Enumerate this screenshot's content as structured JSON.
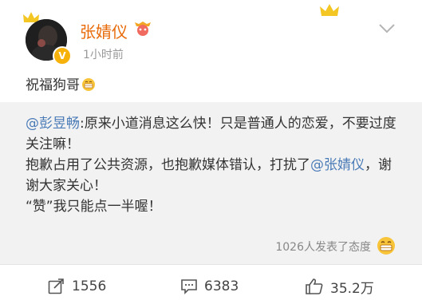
{
  "post": {
    "username": "张婧仪",
    "timestamp": "1小时前",
    "text": "祝福狗哥"
  },
  "repost": {
    "mention_author": "@彭昱畅",
    "segment1": ":原来小道消息这么快！只是普通人的恋爱，不要过度关注嘛！",
    "segment2": "抱歉占用了公共资源，也抱歉媒体错认，打扰了",
    "mention_target": "@张婧仪",
    "segment3": "，谢谢大家关心！",
    "segment4": "“赞”我只能点一半喔！"
  },
  "reactions": {
    "text": "1026人发表了态度"
  },
  "actions": {
    "repost_count": "1556",
    "comment_count": "6383",
    "like_count": "35.2万"
  },
  "colors": {
    "username": "#e86b0a",
    "mention": "#4a7bb7",
    "badge": "#f6b10b"
  }
}
